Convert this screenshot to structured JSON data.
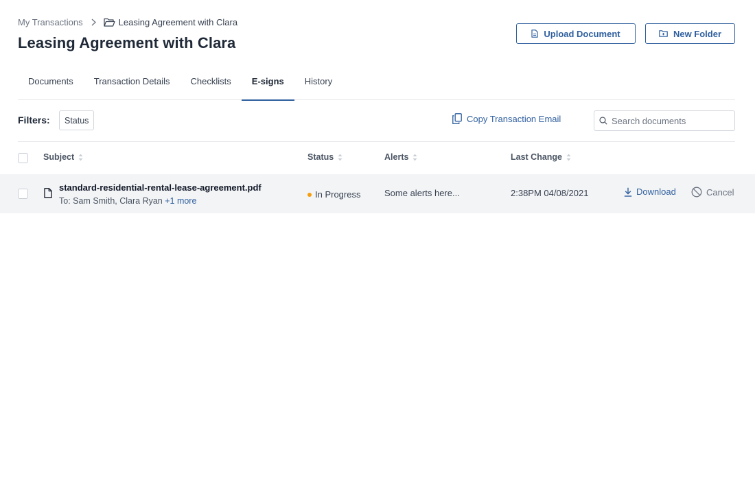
{
  "breadcrumb": {
    "root": "My Transactions",
    "separator_icon": "chevron-right-icon",
    "current_icon": "folder-open-icon",
    "current": "Leasing Agreement with Clara"
  },
  "page_title": "Leasing Agreement with Clara",
  "actions": {
    "upload": {
      "label": "Upload Document",
      "icon": "document-icon"
    },
    "new_folder": {
      "label": "New Folder",
      "icon": "folder-plus-icon"
    }
  },
  "tabs": [
    {
      "label": "Documents",
      "active": false
    },
    {
      "label": "Transaction Details",
      "active": false
    },
    {
      "label": "Checklists",
      "active": false
    },
    {
      "label": "E-signs",
      "active": true
    },
    {
      "label": "History",
      "active": false
    }
  ],
  "toolbar": {
    "filters_label": "Filters:",
    "filter_chip": "Status",
    "copy_email": {
      "label": "Copy Transaction Email",
      "icon": "copy-icon"
    },
    "search": {
      "placeholder": "Search documents",
      "value": "",
      "icon": "search-icon"
    }
  },
  "table": {
    "columns": [
      "Subject",
      "Status",
      "Alerts",
      "Last Change"
    ],
    "rows": [
      {
        "file_name": "standard-residential-rental-lease-agreement.pdf",
        "recipients_prefix": "To: Sam Smith, Clara Ryan ",
        "recipients_more": "+1 more",
        "status": "In Progress",
        "status_color": "#f59e0b",
        "alerts": "Some alerts here...",
        "last_change": "2:38PM 04/08/2021",
        "download_label": "Download",
        "cancel_label": "Cancel"
      }
    ]
  },
  "colors": {
    "accent": "#2f5f9e",
    "row_background": "#f3f4f6",
    "status_in_progress": "#f59e0b"
  }
}
